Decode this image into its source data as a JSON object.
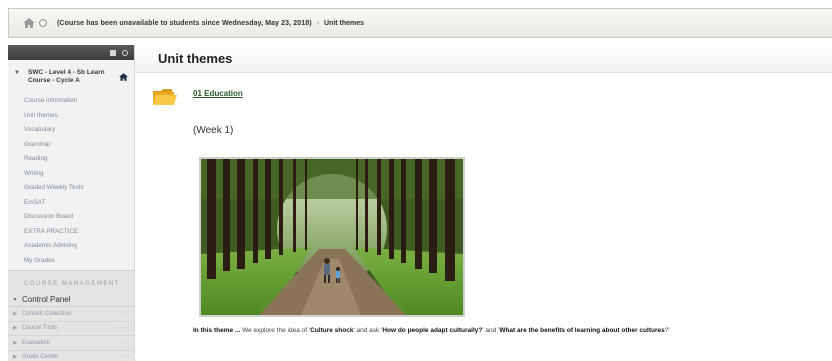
{
  "breadcrumb": {
    "notice": "(Course has been unavailable to students since Wednesday, May 23, 2018)",
    "separator": "›",
    "current": "Unit themes"
  },
  "sidebar": {
    "course_title": "SWC - Level 4 - Sb Learn Course - Cycle A",
    "items": [
      {
        "label": "Course information"
      },
      {
        "label": "Unit themes"
      },
      {
        "label": "Vocabulary"
      },
      {
        "label": "Grammar"
      },
      {
        "label": "Reading"
      },
      {
        "label": "Writing"
      },
      {
        "label": "Graded Weekly Tests"
      },
      {
        "label": "EmSAT"
      },
      {
        "label": "Discussion Board"
      },
      {
        "label": "EXTRA PRACTICE"
      },
      {
        "label": "Academic Advising"
      },
      {
        "label": "My Grades"
      }
    ],
    "management_title": "COURSE MANAGEMENT",
    "control_panel": "Control Panel",
    "control_items": [
      {
        "label": "Content Collection",
        "dots": "·····"
      },
      {
        "label": "Course Tools",
        "dots": "·····"
      },
      {
        "label": "Evaluation",
        "dots": "·····"
      },
      {
        "label": "Grade Center",
        "dots": "·····"
      }
    ]
  },
  "main": {
    "title": "Unit themes",
    "item": {
      "link": "01 Education",
      "week": "(Week 1)",
      "desc_lead": "In this theme ...",
      "desc_1": " We explore the idea of '",
      "desc_b1": "Culture shock",
      "desc_2": "' and ask '",
      "desc_b2": "How do people adapt culturally?",
      "desc_3": "' and '",
      "desc_b3": "What are the benefits of learning about other cultures",
      "desc_4": "?'"
    }
  },
  "colors": {
    "breadcrumb_bg": "#eceee6",
    "sidebar_bg": "#f2f2f2",
    "sidebar_header": "#4a4a4a",
    "link_green": "#2a5a2a",
    "folder_yellow": "#f2b52a"
  },
  "icons": {
    "home": "home-icon",
    "folder": "folder-icon",
    "course_home": "house-icon"
  }
}
